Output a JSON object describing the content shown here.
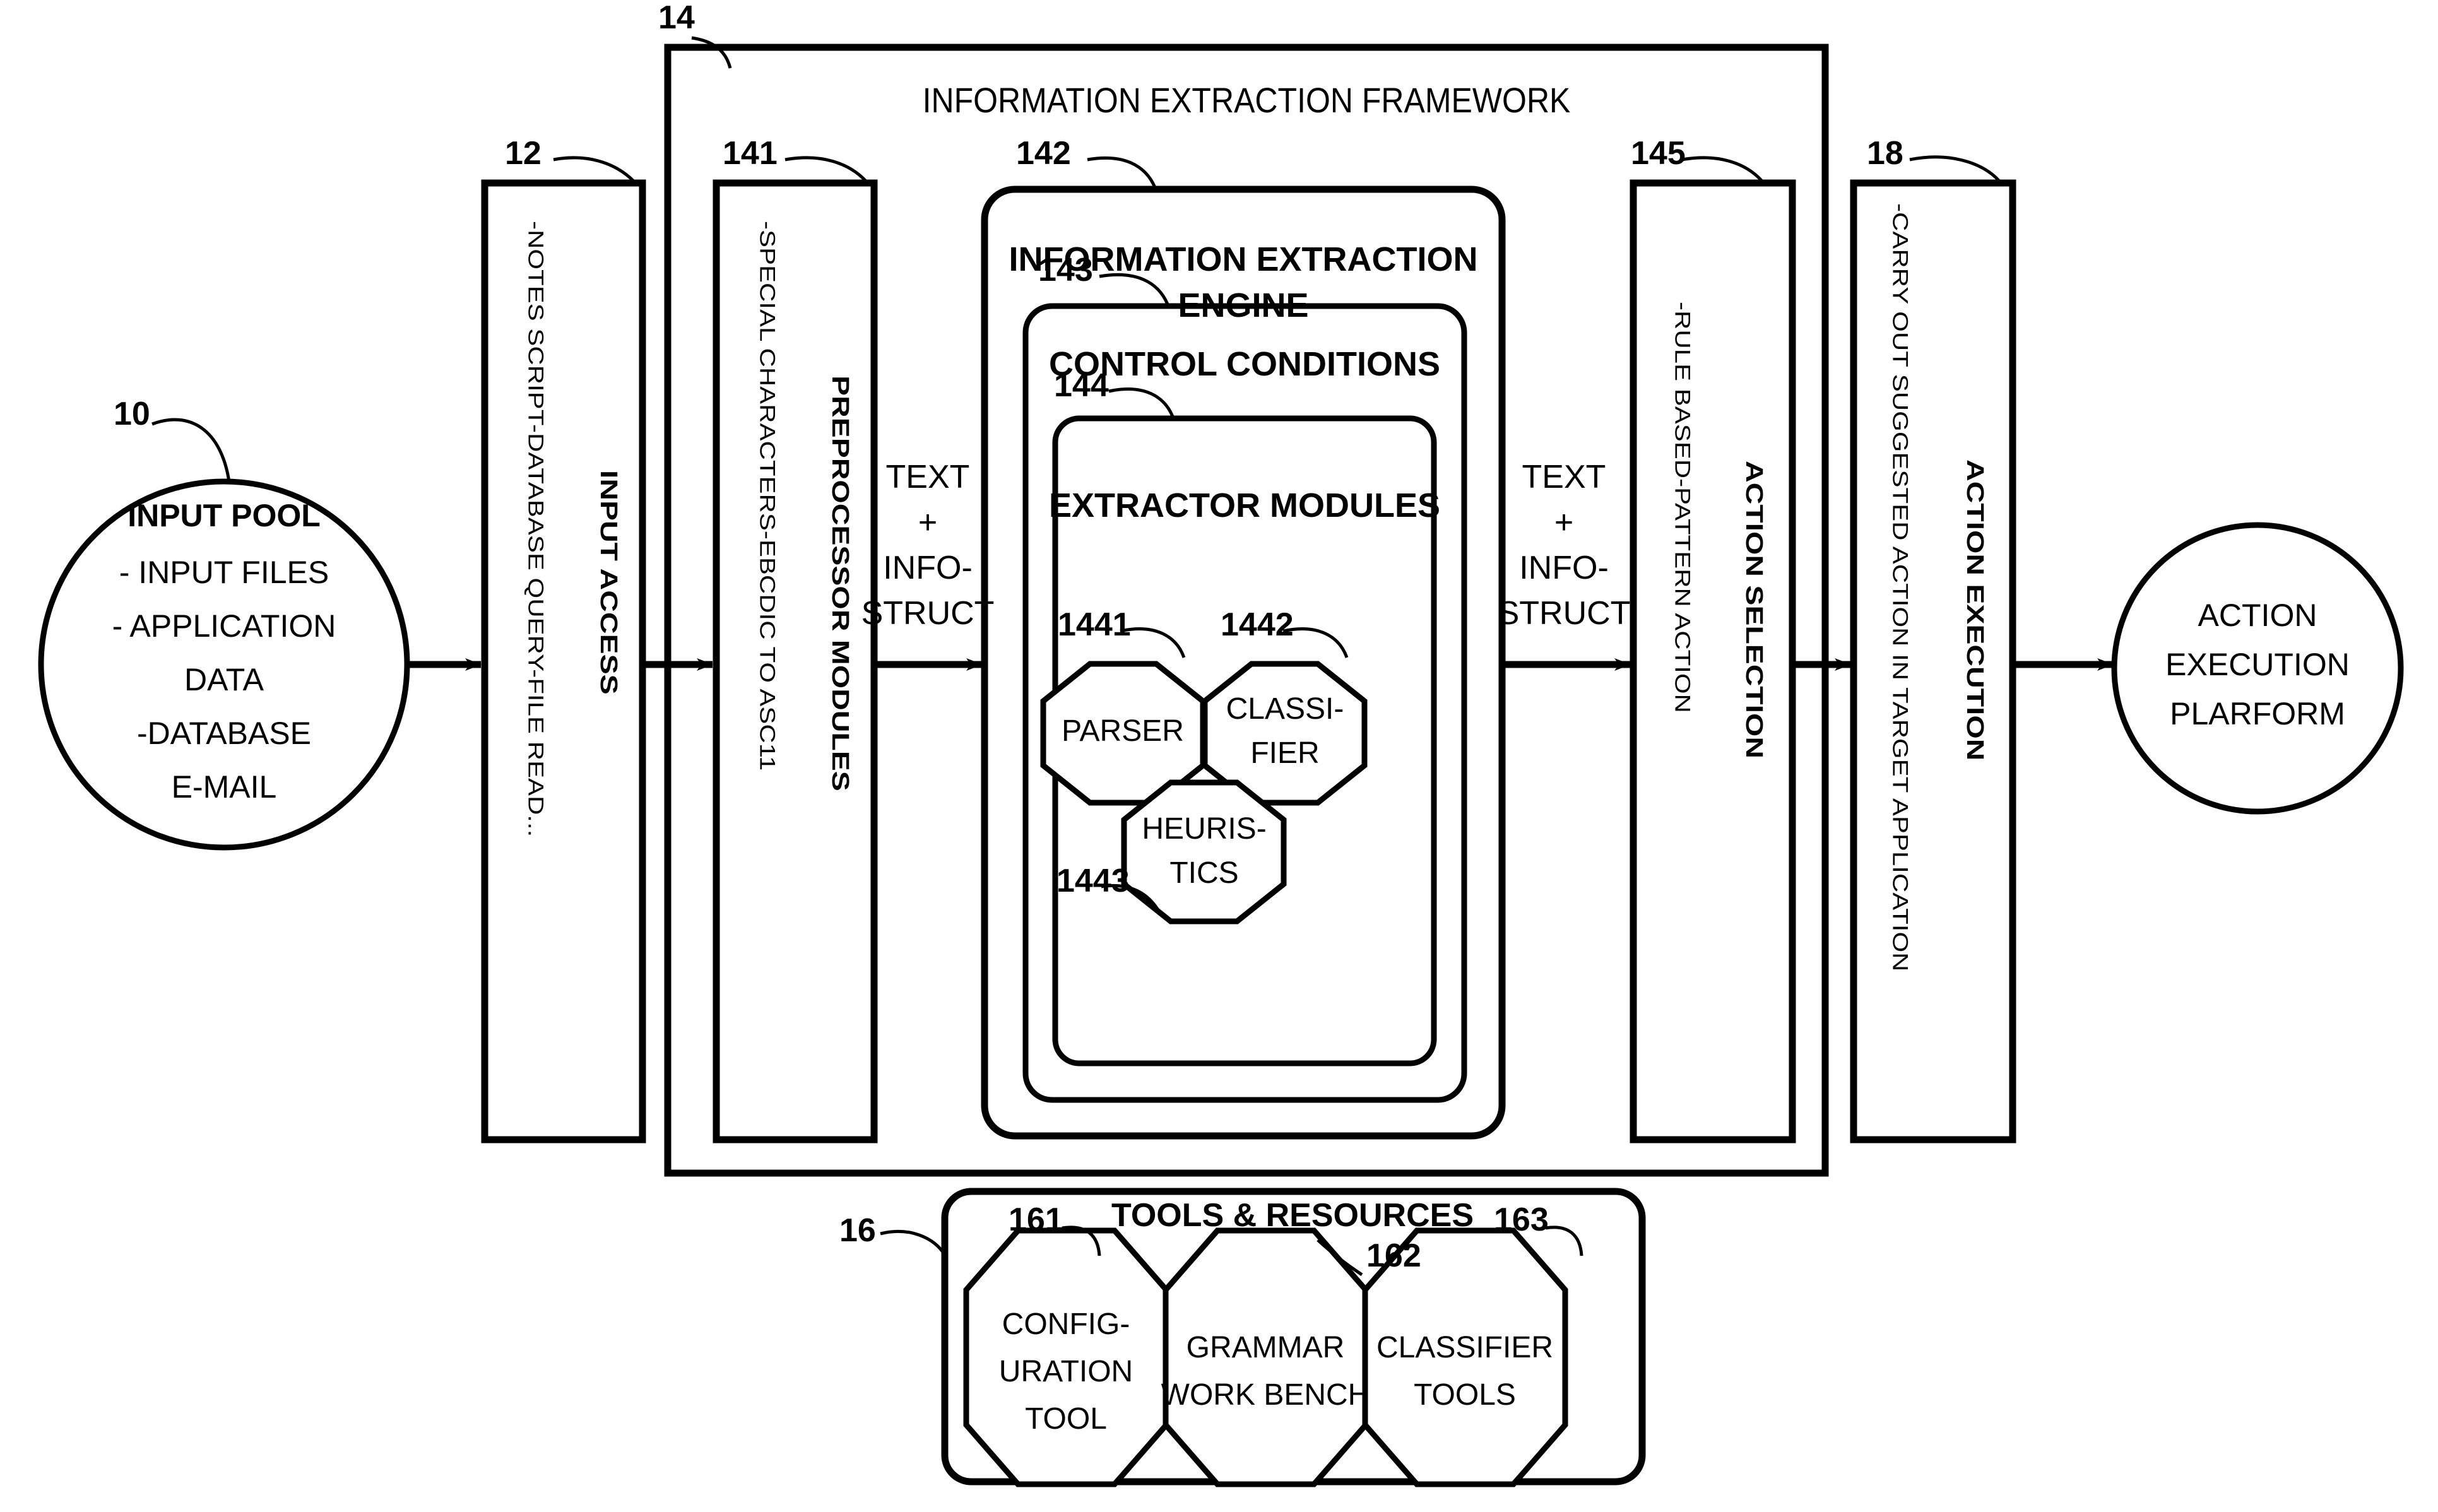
{
  "figure": {
    "title": "INFORMATION EXTRACTION FRAMEWORK",
    "framework_ref": "14"
  },
  "input_pool": {
    "ref": "10",
    "title": "INPUT POOL",
    "items": [
      "- INPUT FILES",
      "- APPLICATION",
      "DATA",
      "-DATABASE",
      "E-MAIL"
    ]
  },
  "input_access": {
    "ref": "12",
    "title": "INPUT ACCESS",
    "detail": "-NOTES SCRIPT-DATABASE QUERY-FILE READ..."
  },
  "preprocessor": {
    "ref": "141",
    "title": "PREPROCESSOR MODULES",
    "detail": "-SPECIAL CHARACTERS-EBCDIC TO ASC11"
  },
  "flow_label_1": {
    "line1": "TEXT",
    "line2": "+",
    "line3": "INFO-",
    "line4": "STRUCT"
  },
  "flow_label_2": {
    "line1": "TEXT",
    "line2": "+",
    "line3": "INFO-",
    "line4": "STRUCT"
  },
  "engine": {
    "ref": "142",
    "title_line1": "INFORMATION EXTRACTION",
    "title_line2": "ENGINE"
  },
  "control_conditions": {
    "ref": "143",
    "title": "CONTROL CONDITIONS"
  },
  "extractor_modules": {
    "ref": "144",
    "title": "EXTRACTOR MODULES",
    "nodes": [
      {
        "ref": "1441",
        "label_line1": "PARSER",
        "label_line2": ""
      },
      {
        "ref": "1442",
        "label_line1": "CLASSI-",
        "label_line2": "FIER"
      },
      {
        "ref": "1443",
        "label_line1": "HEURIS-",
        "label_line2": "TICS"
      }
    ]
  },
  "action_selection": {
    "ref": "145",
    "title": "ACTION SELECTION",
    "detail": "-RULE BASED-PATTERN ACTION"
  },
  "action_execution": {
    "ref": "18",
    "title": "ACTION EXECUTION",
    "detail": "-CARRY OUT SUGGESTED ACTION IN TARGET APPLICATION"
  },
  "action_platform": {
    "line1": "ACTION",
    "line2": "EXECUTION",
    "line3": "PLARFORM"
  },
  "tools_resources": {
    "ref": "16",
    "title": "TOOLS & RESOURCES",
    "tools": [
      {
        "ref": "161",
        "line1": "CONFIG-",
        "line2": "URATION",
        "line3": "TOOL"
      },
      {
        "ref": "162",
        "line1": "GRAMMAR",
        "line2": "WORK BENCH",
        "line3": ""
      },
      {
        "ref": "163",
        "line1": "CLASSIFIER",
        "line2": "TOOLS",
        "line3": ""
      }
    ]
  },
  "colors": {
    "ink": "#000000",
    "paper": "#ffffff"
  }
}
